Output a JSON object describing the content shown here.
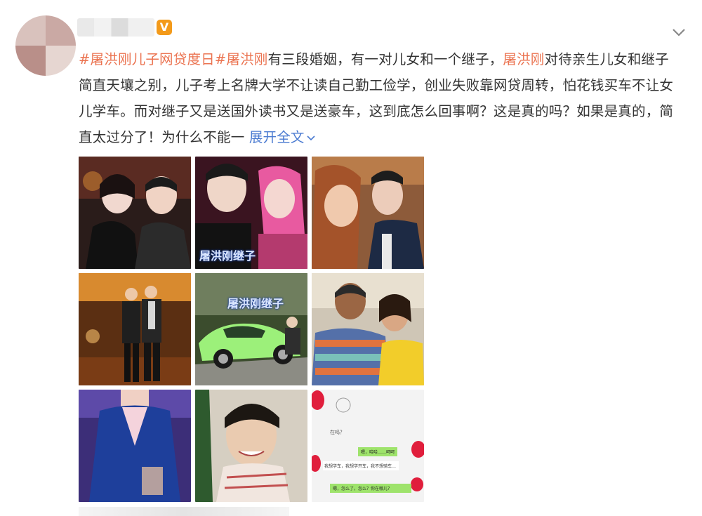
{
  "post": {
    "verified_badge": "V",
    "segments": [
      {
        "text": "#屠洪刚儿子网贷度日#",
        "kind": "tag"
      },
      {
        "text": "屠洪刚",
        "kind": "mention"
      },
      {
        "text": "有三段婚姻，有一对儿女和一个继子，",
        "kind": "plain"
      },
      {
        "text": "屠洪刚",
        "kind": "mention"
      },
      {
        "text": "对待亲生儿女和继子简直天壤之别，儿子考上名牌大学不让读自己勤工俭学，创业失败靠网贷周转，怕花钱买车不让女儿学车。而对继子又是送国外读书又是送豪车，这到底怎么回事啊？这是真的吗？如果是真的，简直太过分了！为什么不能一 ",
        "kind": "plain"
      }
    ],
    "expand_label": "展开全文",
    "watermark_1": "屠洪刚继子",
    "watermark_2": "屠洪刚继子",
    "chat": {
      "msg1": "在吗？",
      "msg2": "嗯，哈哈……呵呵",
      "msg3": "我想学车，我想学开车，我不想骑车…",
      "msg4": "嗯，怎么了，怎么？你在哪儿？"
    }
  },
  "icons": {
    "chevron": "chevron-down-icon",
    "expand_chevron": "chevron-down-icon"
  },
  "colors": {
    "tag": "#eb7350",
    "link": "#4b7bd1",
    "badge": "#f39a1a",
    "chat_green": "#9ee36b"
  }
}
